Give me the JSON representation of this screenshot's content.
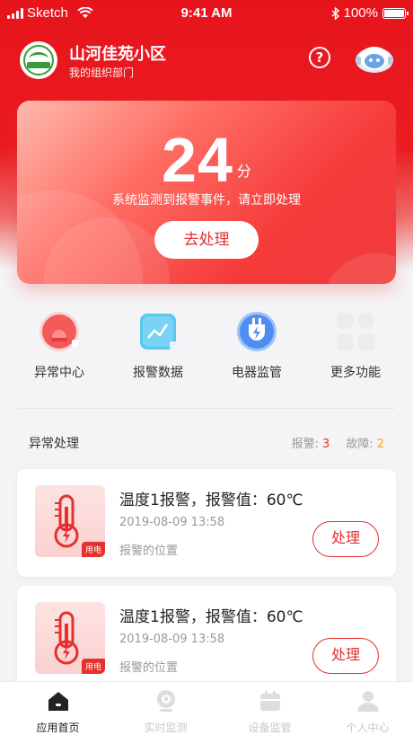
{
  "status_bar": {
    "carrier": "Sketch",
    "time": "9:41 AM",
    "battery": "100%"
  },
  "header": {
    "title": "山河佳苑小区",
    "subtitle": "我的组织部门"
  },
  "score_card": {
    "score": "24",
    "unit": "分",
    "message": "系统监测到报警事件，请立即处理",
    "button": "去处理"
  },
  "functions": [
    {
      "label": "异常中心",
      "icon": "alarm-light-icon"
    },
    {
      "label": "报警数据",
      "icon": "chart-data-icon"
    },
    {
      "label": "电器监管",
      "icon": "plug-icon"
    },
    {
      "label": "更多功能",
      "icon": "grid-more-icon"
    }
  ],
  "section": {
    "title": "异常处理",
    "alarm_label": "报警:",
    "alarm_count": "3",
    "fault_label": "故障:",
    "fault_count": "2"
  },
  "alarms": [
    {
      "title": "温度1报警，报警值：60℃",
      "time": "2019-08-09 13:58",
      "location": "报警的位置",
      "tag": "用电",
      "button": "处理"
    },
    {
      "title": "温度1报警，报警值：60℃",
      "time": "2019-08-09 13:58",
      "location": "报警的位置",
      "tag": "用电",
      "button": "处理"
    }
  ],
  "tabs": [
    {
      "label": "应用首页",
      "icon": "home-icon",
      "active": true
    },
    {
      "label": "实时监测",
      "icon": "camera-icon",
      "active": false
    },
    {
      "label": "设备监管",
      "icon": "calendar-icon",
      "active": false
    },
    {
      "label": "个人中心",
      "icon": "person-icon",
      "active": false
    }
  ],
  "colors": {
    "primary_red": "#e8141c",
    "alarm_count": "#e5302e",
    "fault_count": "#f5a623"
  }
}
